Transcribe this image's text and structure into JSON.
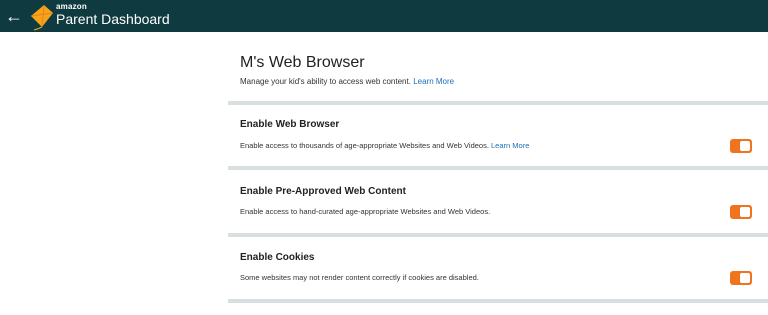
{
  "header": {
    "brand_small": "amazon",
    "brand_title": "Parent Dashboard",
    "back_icon": "←",
    "bar_color": "#0e3a40",
    "logo_color": "#f7a21b"
  },
  "page": {
    "title": "M's Web Browser",
    "description": "Manage your kid's ability to access web content.",
    "learn_more": "Learn More"
  },
  "settings": [
    {
      "title": "Enable Web Browser",
      "description": "Enable access to thousands of age-appropriate Websites and Web Videos.",
      "learn_more": "Learn More",
      "enabled": true
    },
    {
      "title": "Enable Pre-Approved Web Content",
      "description": "Enable access to hand-curated age-appropriate Websites and Web Videos.",
      "enabled": true
    },
    {
      "title": "Enable Cookies",
      "description": "Some websites may not render content correctly if cookies are disabled.",
      "enabled": true
    }
  ],
  "toggle_color": "#f0741d"
}
